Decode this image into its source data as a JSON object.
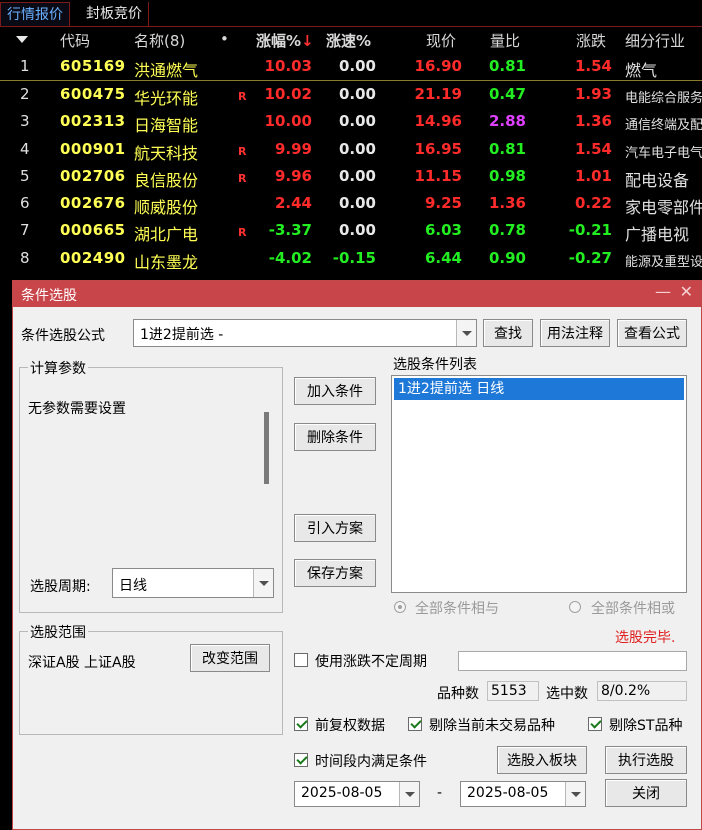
{
  "tabs": [
    {
      "label": "行情报价"
    },
    {
      "label": "封板竞价"
    }
  ],
  "quote_header": {
    "code": "代码",
    "name": "名称(8)",
    "dot": "•",
    "pct": "涨幅%",
    "pct_sort": "↓",
    "speed": "涨速%",
    "price": "现价",
    "vol_ratio": "量比",
    "change": "涨跌",
    "industry": "细分行业"
  },
  "quotes": [
    {
      "idx": "1",
      "code": "605169",
      "name": "洪通燃气",
      "r": "",
      "pct": "10.03",
      "speed": "0.00",
      "price": "16.90",
      "vol": "0.81",
      "chg": "1.54",
      "industry": "燃气"
    },
    {
      "idx": "2",
      "code": "600475",
      "name": "华光环能",
      "r": "R",
      "pct": "10.02",
      "speed": "0.00",
      "price": "21.19",
      "vol": "0.47",
      "chg": "1.93",
      "industry": "电能综合服务"
    },
    {
      "idx": "3",
      "code": "002313",
      "name": "日海智能",
      "r": "",
      "pct": "10.00",
      "speed": "0.00",
      "price": "14.96",
      "vol": "2.88",
      "chg": "1.36",
      "industry": "通信终端及配件"
    },
    {
      "idx": "4",
      "code": "000901",
      "name": "航天科技",
      "r": "R",
      "pct": "9.99",
      "speed": "0.00",
      "price": "16.95",
      "vol": "0.81",
      "chg": "1.54",
      "industry": "汽车电子电气"
    },
    {
      "idx": "5",
      "code": "002706",
      "name": "良信股份",
      "r": "R",
      "pct": "9.96",
      "speed": "0.00",
      "price": "11.15",
      "vol": "0.98",
      "chg": "1.01",
      "industry": "配电设备"
    },
    {
      "idx": "6",
      "code": "002676",
      "name": "顺威股份",
      "r": "",
      "pct": "2.44",
      "speed": "0.00",
      "price": "9.25",
      "vol": "1.36",
      "chg": "0.22",
      "industry": "家电零部件"
    },
    {
      "idx": "7",
      "code": "000665",
      "name": "湖北广电",
      "r": "R",
      "pct": "-3.37",
      "speed": "0.00",
      "price": "6.03",
      "vol": "0.78",
      "chg": "-0.21",
      "industry": "广播电视"
    },
    {
      "idx": "8",
      "code": "002490",
      "name": "山东墨龙",
      "r": "",
      "pct": "-4.02",
      "speed": "-0.15",
      "price": "6.44",
      "vol": "0.90",
      "chg": "-0.27",
      "industry": "能源及重型设备"
    }
  ],
  "dialog": {
    "title": "条件选股",
    "formula_label": "条件选股公式",
    "formula_value": "1进2提前选  -",
    "find_button": "查找",
    "usage_button": "用法注释",
    "view_formula_button": "查看公式",
    "params_group": "计算参数",
    "params_text": "无参数需要设置",
    "period_label": "选股周期:",
    "period_value": "日线",
    "add_condition": "加入条件",
    "delete_condition": "删除条件",
    "import_plan": "引入方案",
    "save_plan": "保存方案",
    "condition_list_label": "选股条件列表",
    "condition_item": "1进2提前选  日线",
    "radio_and": "全部条件相与",
    "radio_or": "全部条件相或",
    "status": "选股完毕.",
    "range_group": "选股范围",
    "range_text": "深证A股 上证A股",
    "change_range": "改变范围",
    "use_period_label": "使用涨跌不定周期",
    "count_label": "品种数",
    "count_value": "5153",
    "selected_label": "选中数",
    "selected_value": "8/0.2%",
    "chk_adjust": "前复权数据",
    "chk_exclude_untraded": "剔除当前未交易品种",
    "chk_exclude_st": "剔除ST品种",
    "chk_time_range": "时间段内满足条件",
    "to_block_button": "选股入板块",
    "execute_button": "执行选股",
    "date_from": "2025-08-05",
    "date_sep": "-",
    "date_to": "2025-08-05",
    "close_button": "关闭"
  }
}
